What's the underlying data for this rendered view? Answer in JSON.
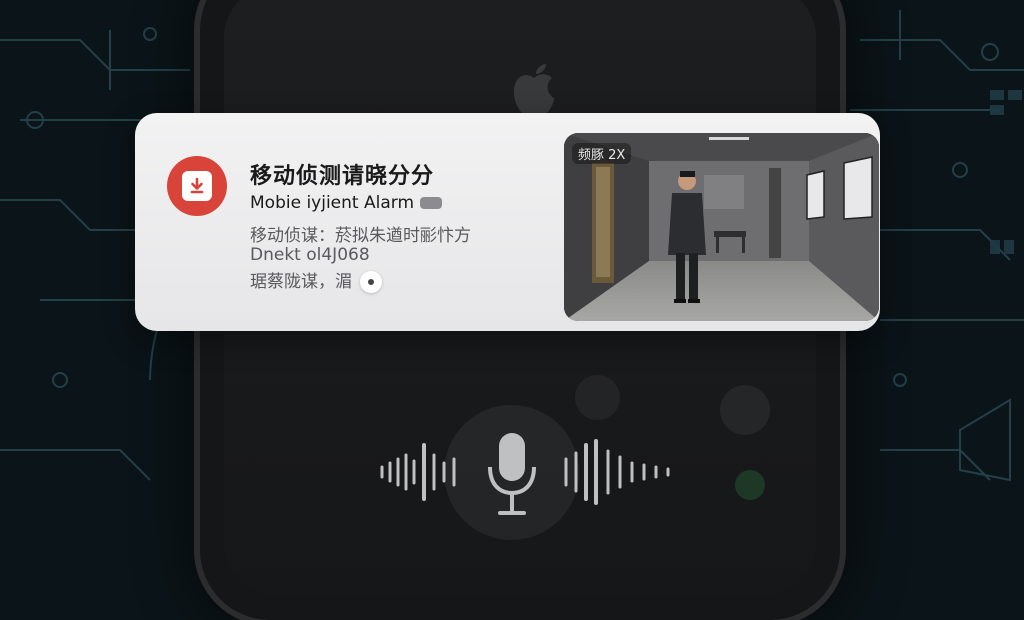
{
  "notification": {
    "title": "移动侦测请晓分分",
    "app_name": "Mobie iyjient Alarm",
    "line1": "移动侦谋：菸拟朱遒时彨忭方",
    "line2": "Dnekt ol4J068",
    "line3": "琚蔡陇谋，湄",
    "thumbnail_label": "频豚 2X",
    "app_icon": "download-icon",
    "accent": "#d8443a"
  },
  "voice": {
    "mic_icon": "microphone-icon"
  }
}
